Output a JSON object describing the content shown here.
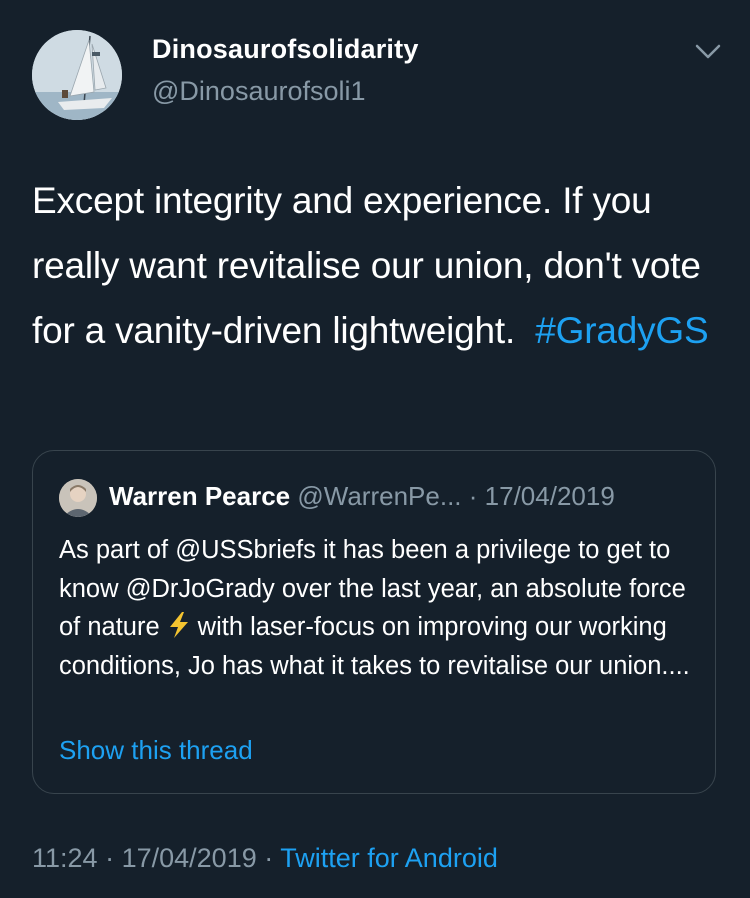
{
  "author": {
    "display_name": "Dinosaurofsolidarity",
    "handle": "@Dinosaurofsoli1",
    "avatar_icon": "sailboat-avatar"
  },
  "tweet": {
    "text": "Except integrity and experience. If you really want revitalise our union, don't vote for a vanity-driven lightweight.",
    "hashtag": "#GradyGS"
  },
  "quoted": {
    "display_name": "Warren Pearce",
    "handle": "@WarrenPe...",
    "separator": "·",
    "date": "17/04/2019",
    "text_before_emoji": "As part of @USSbriefs it has been a privilege to get to know @DrJoGrady over the last year, an absolute force of nature",
    "emoji_icon": "lightning-bolt-icon",
    "text_after_emoji": "with laser-focus on improving our working conditions, Jo has what it takes to revitalise our union....",
    "show_thread_label": "Show this thread"
  },
  "footer": {
    "time": "11:24",
    "separator": "·",
    "date": "17/04/2019",
    "source": "Twitter for Android"
  },
  "colors": {
    "background": "#15202b",
    "link": "#1da1f2",
    "muted": "#8899a6",
    "border": "#38444d",
    "emoji": "#f4c430"
  }
}
